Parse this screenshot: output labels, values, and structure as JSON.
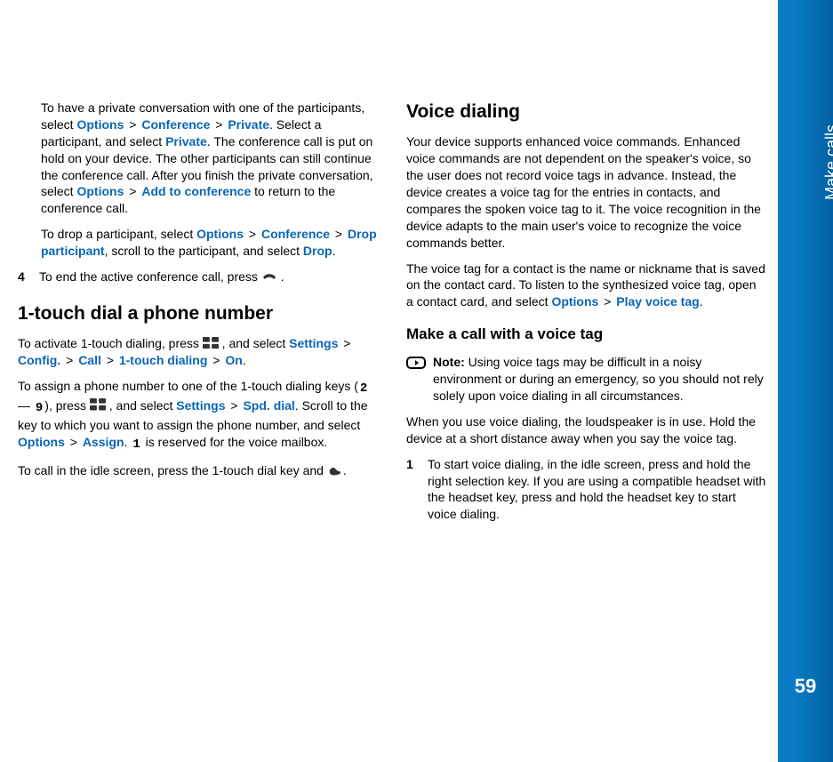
{
  "page": {
    "section": "Make calls",
    "number": "59"
  },
  "ui_terms": {
    "options": "Options",
    "conference": "Conference",
    "private": "Private",
    "add_to_conference": "Add to conference",
    "drop_participant": "Drop participant",
    "drop": "Drop",
    "settings": "Settings",
    "config": "Config.",
    "call": "Call",
    "one_touch_dialing": "1-touch dialing",
    "on": "On",
    "spd_dial": "Spd. dial",
    "assign": "Assign",
    "play_voice_tag": "Play voice tag"
  },
  "icons": {
    "menu_key": "menu-key-icon",
    "end_key": "end-key-icon",
    "send_key": "send-key-icon",
    "key2": "2",
    "key9": "9",
    "key1": "1",
    "note": "note-icon"
  },
  "left": {
    "priv_intro": "To have a private conversation with one of the participants, select ",
    "priv_mid1": ". Select a participant, and select ",
    "priv_mid2": ". The conference call is put on hold on your device. The other participants can still continue the conference call. After you finish the private conversation, select ",
    "priv_tail": " to return to the conference call.",
    "drop_intro": "To drop a participant, select ",
    "drop_mid": ", scroll to the participant, and select ",
    "drop_tail": ".",
    "step4": {
      "n": "4",
      "text_a": "To end the active conference call, press ",
      "text_b": "."
    },
    "h_one_touch": "1-touch dial a phone number",
    "activate_a": "To activate 1-touch dialing, press ",
    "activate_b": ", and select ",
    "activate_tail": ".",
    "assign_a": "To assign a phone number to one of the 1-touch dialing keys (",
    "dash": " — ",
    "assign_b": "), press ",
    "assign_c": ", and select ",
    "assign_d": ". Scroll to the key to which you want to assign the phone number, and select ",
    "assign_e": ". ",
    "assign_f": " is reserved for the voice mailbox.",
    "tocall_a": "To call in the idle screen, press the 1-touch dial key and ",
    "tocall_b": "."
  },
  "right": {
    "h_voice_dialing": "Voice dialing",
    "p1": "Your device supports enhanced voice commands. Enhanced voice commands are not dependent on the speaker's voice, so the user does not record voice tags in advance. Instead, the device creates a voice tag for the entries in contacts, and compares the spoken voice tag to it. The voice recognition in the device adapts to the main user's voice to recognize the voice commands better.",
    "p2_a": "The voice tag for a contact is the name or nickname that is saved on the contact card. To listen to the synthesized voice tag, open a contact card, and select ",
    "p2_b": ".",
    "h_make_call": "Make a call with a voice tag",
    "note_label": "Note:",
    "note_text": " Using voice tags may be difficult in a noisy environment or during an emergency, so you should not rely solely upon voice dialing in all circumstances.",
    "loud": "When you use voice dialing, the loudspeaker is in use. Hold the device at a short distance away when you say the voice tag.",
    "step1": {
      "n": "1",
      "text": "To start voice dialing, in the idle screen, press and hold the right selection key. If you are using a compatible headset with the headset key, press and hold the headset key to start voice dialing."
    }
  }
}
